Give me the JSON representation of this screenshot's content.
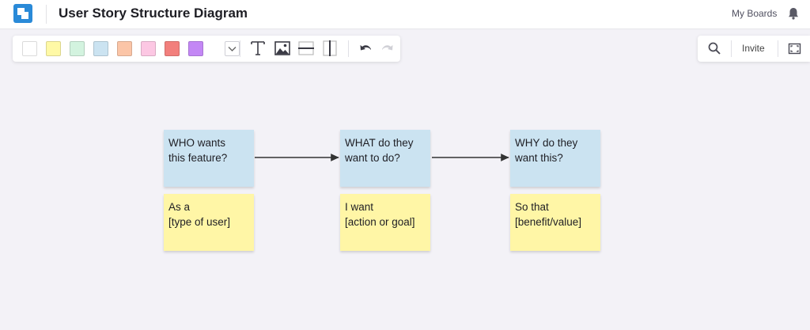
{
  "header": {
    "title": "User Story Structure Diagram",
    "my_boards": "My Boards",
    "logo_icon": "app-logo-icon",
    "bell_icon": "bell-icon"
  },
  "toolbar": {
    "colors": [
      "#ffffff",
      "#fff9a6",
      "#d3f3df",
      "#cbe3f1",
      "#fbc5a7",
      "#fcc7e3",
      "#f27f7c",
      "#c387f5"
    ],
    "more_colors_icon": "chevron-down-icon",
    "tools": [
      "text-tool-icon",
      "image-tool-icon",
      "horizontal-divider-icon",
      "vertical-divider-icon",
      "undo-icon",
      "redo-icon"
    ]
  },
  "right_tools": {
    "search_icon": "search-icon",
    "invite": "Invite",
    "fit_icon": "fit-screen-icon"
  },
  "diagram": {
    "columns": [
      {
        "question": [
          "WHO wants",
          "this feature?"
        ],
        "answer": [
          "As a",
          "[type of user]"
        ]
      },
      {
        "question": [
          "WHAT do they",
          "want to do?"
        ],
        "answer": [
          "I want",
          "[action or goal]"
        ]
      },
      {
        "question": [
          "WHY do they",
          "want this?"
        ],
        "answer": [
          "So that",
          "[benefit/value]"
        ]
      }
    ],
    "question_color": "#cbe3f1",
    "answer_color": "#fff6a6"
  }
}
